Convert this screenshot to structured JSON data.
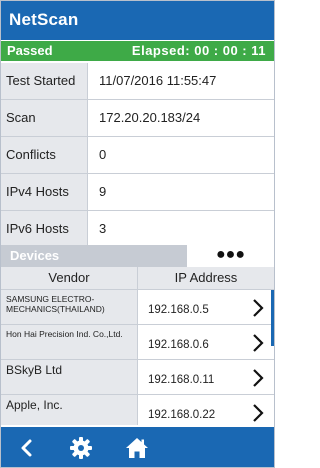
{
  "header": {
    "title": "NetScan"
  },
  "status": {
    "label": "Passed",
    "elapsed": "Elapsed: 00 : 00 : 11",
    "color": "#3eaa47"
  },
  "info_rows": [
    {
      "label": "Test Started",
      "value": "11/07/2016 11:55:47"
    },
    {
      "label": "Scan",
      "value": "172.20.20.183/24"
    },
    {
      "label": "Conflicts",
      "value": "0"
    },
    {
      "label": "IPv4 Hosts",
      "value": "9"
    },
    {
      "label": "IPv6 Hosts",
      "value": "3"
    }
  ],
  "devices": {
    "tab_label": "Devices",
    "more_label": "●●●"
  },
  "table": {
    "headers": {
      "vendor": "Vendor",
      "ip": "IP Address"
    },
    "rows": [
      {
        "vendor": "SAMSUNG ELECTRO-MECHANICS(THAILAND)",
        "ip": "192.168.0.5"
      },
      {
        "vendor": "Hon Hai Precision Ind. Co.,Ltd.",
        "ip": "192.168.0.6"
      },
      {
        "vendor": "BSkyB Ltd",
        "ip": "192.168.0.11"
      },
      {
        "vendor": "Apple, Inc.",
        "ip": "192.168.0.22"
      }
    ]
  },
  "footer": {
    "icons": [
      "back-icon",
      "gear-icon",
      "home-icon"
    ]
  },
  "colors": {
    "primary": "#1a68b3",
    "passed": "#3eaa47",
    "label_bg": "#e6e8ec"
  }
}
